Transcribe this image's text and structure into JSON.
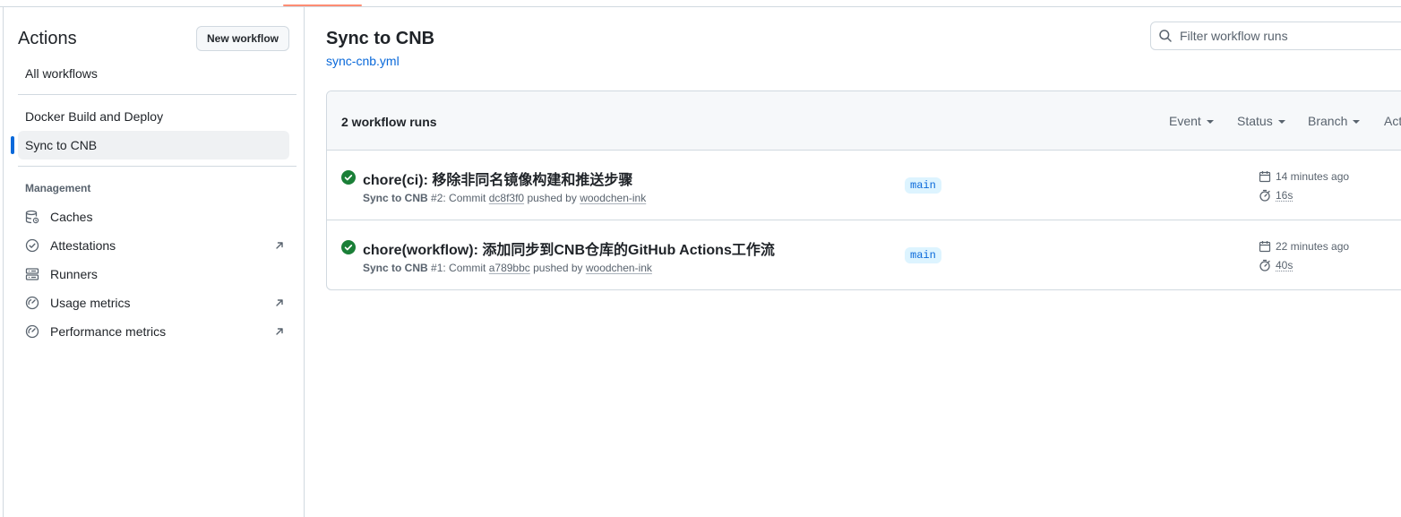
{
  "sidebar": {
    "title": "Actions",
    "new_workflow_label": "New workflow",
    "all_workflows_label": "All workflows",
    "workflows": [
      {
        "label": "Docker Build and Deploy"
      },
      {
        "label": "Sync to CNB",
        "selected": true
      }
    ],
    "management_label": "Management",
    "management": [
      {
        "label": "Caches",
        "icon": "database-icon",
        "external": false
      },
      {
        "label": "Attestations",
        "icon": "verified-icon",
        "external": true
      },
      {
        "label": "Runners",
        "icon": "server-icon",
        "external": false
      },
      {
        "label": "Usage metrics",
        "icon": "meter-icon",
        "external": true
      },
      {
        "label": "Performance metrics",
        "icon": "meter-icon",
        "external": true
      }
    ]
  },
  "main": {
    "title": "Sync to CNB",
    "file": "sync-cnb.yml",
    "filter_placeholder": "Filter workflow runs",
    "runs_count": "2 workflow runs",
    "filters": [
      "Event",
      "Status",
      "Branch",
      "Actor"
    ],
    "runs": [
      {
        "title": "chore(ci): 移除非同名镜像构建和推送步骤",
        "workflow": "Sync to CNB",
        "run_number": "#2",
        "commit_prefix": ": Commit",
        "commit": "dc8f3f0",
        "pushed_by": "pushed by",
        "author": "woodchen-ink",
        "branch": "main",
        "time": "14 minutes ago",
        "duration": "16s",
        "status": "success"
      },
      {
        "title": "chore(workflow): 添加同步到CNB仓库的GitHub Actions工作流",
        "workflow": "Sync to CNB",
        "run_number": "#1",
        "commit_prefix": ": Commit",
        "commit": "a789bbc",
        "pushed_by": "pushed by",
        "author": "woodchen-ink",
        "branch": "main",
        "time": "22 minutes ago",
        "duration": "40s",
        "status": "success"
      }
    ]
  },
  "colors": {
    "accent": "#0969da",
    "success": "#1a7f37",
    "tab_underline": "#fd8c73",
    "border": "#d1d9e0"
  }
}
